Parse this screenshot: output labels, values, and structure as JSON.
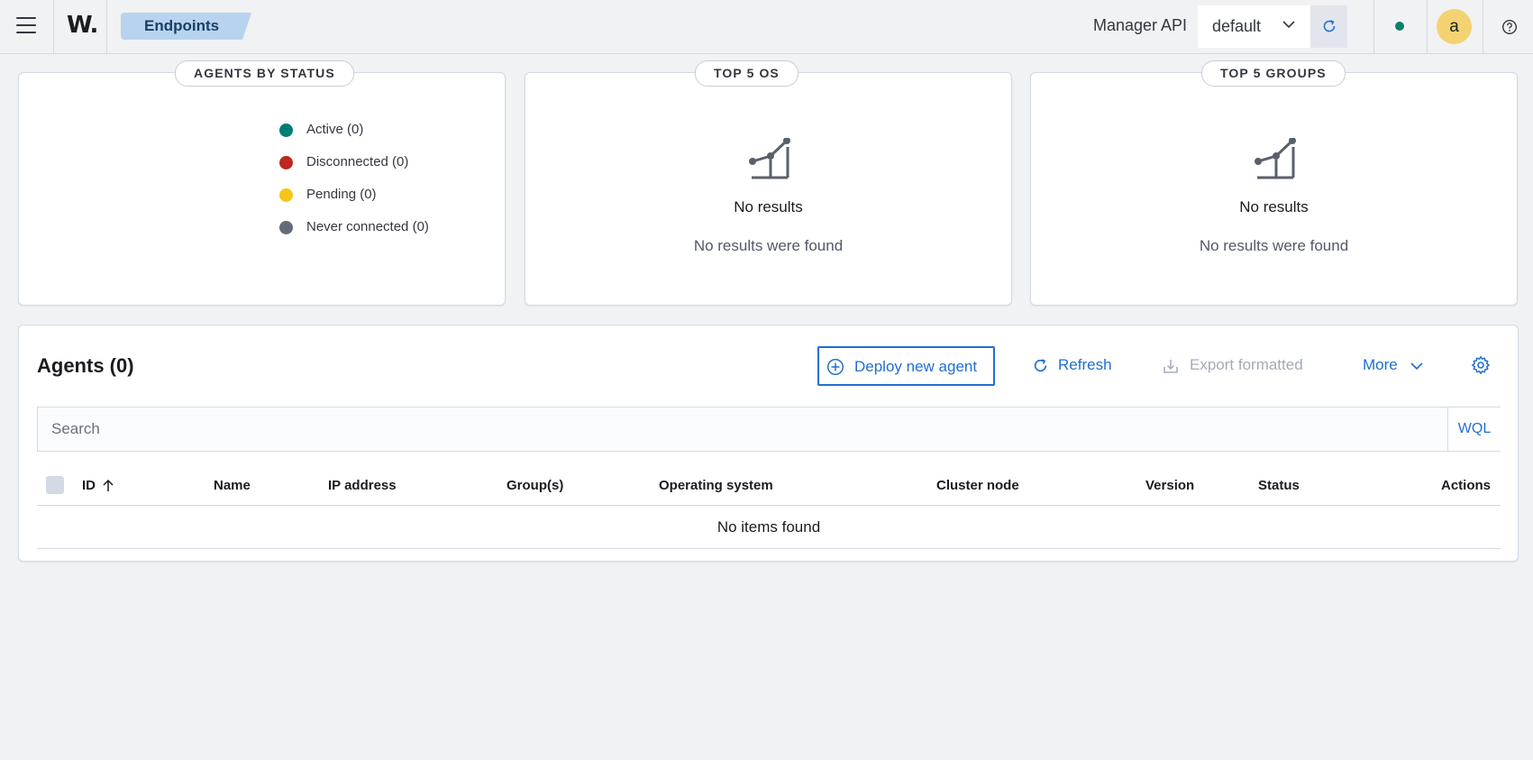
{
  "header": {
    "logo_text": "W.",
    "breadcrumb": "Endpoints",
    "manager_api_label": "Manager API",
    "api_selected": "default",
    "avatar_initial": "a",
    "status_color": "#0b7f6c"
  },
  "panels": {
    "status": {
      "title": "AGENTS BY STATUS",
      "legend": [
        {
          "label": "Active (0)",
          "color": "#017d73"
        },
        {
          "label": "Disconnected (0)",
          "color": "#bd271e"
        },
        {
          "label": "Pending (0)",
          "color": "#f5c518"
        },
        {
          "label": "Never connected (0)",
          "color": "#646a77"
        }
      ]
    },
    "os": {
      "title": "TOP 5 OS",
      "no_results_title": "No results",
      "no_results_text": "No results were found"
    },
    "groups": {
      "title": "TOP 5 GROUPS",
      "no_results_title": "No results",
      "no_results_text": "No results were found"
    }
  },
  "agents": {
    "title": "Agents (0)",
    "deploy_label": "Deploy new agent",
    "refresh_label": "Refresh",
    "export_label": "Export formatted",
    "more_label": "More",
    "search_placeholder": "Search",
    "wql_label": "WQL",
    "columns": [
      "ID",
      "Name",
      "IP address",
      "Group(s)",
      "Operating system",
      "Cluster node",
      "Version",
      "Status",
      "Actions"
    ],
    "empty_text": "No items found"
  }
}
